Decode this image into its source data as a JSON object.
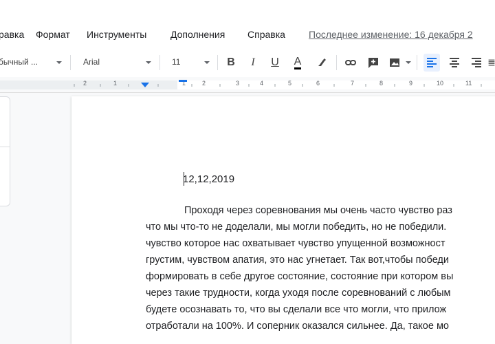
{
  "menu": {
    "items": [
      "равка",
      "Формат",
      "Инструменты",
      "Дополнения",
      "Справка"
    ],
    "last_edit": "Последнее изменение: 16 декабря 2"
  },
  "toolbar": {
    "style_select": "бычный ...",
    "font_select": "Arial",
    "size_select": "11",
    "bold": "B",
    "italic": "I",
    "underline": "U",
    "text_color": "A"
  },
  "ruler": {
    "labels": [
      "2",
      "1",
      "1",
      "2",
      "3",
      "4",
      "5",
      "6",
      "7",
      "8",
      "9",
      "10",
      "11"
    ]
  },
  "document": {
    "date": "12,12,2019",
    "lines": [
      "Проходя через соревнования  мы очень часто чувство раз",
      "что мы что-то не доделали, мы могли победить, но не победили.",
      "чувство которое нас охватывает чувство упущенной возможност",
      "грустим, чувством апатия, это нас угнетает. Так вот,чтобы победи",
      "формировать в себе другое состояние, состояние при котором вы",
      "через такие трудности, когда уходя после соревнований с любым",
      "будете осознавать то, что вы сделали все что могли, что прилож",
      "отработали на 100%. И соперник оказался сильнее. Да, такое мо"
    ]
  },
  "colors": {
    "accent": "#1a73e8",
    "text_color_underline": "#000000"
  }
}
